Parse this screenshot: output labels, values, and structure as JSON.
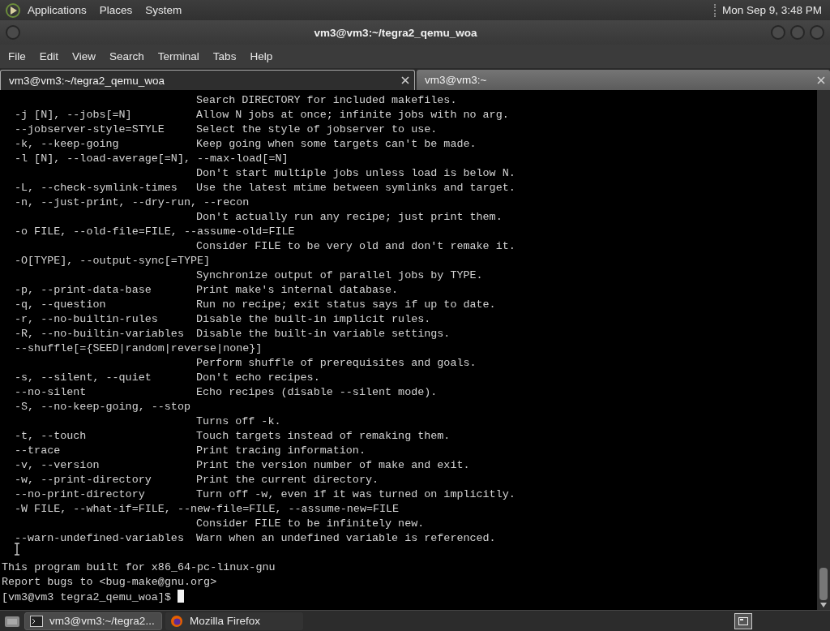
{
  "top_panel": {
    "menus": [
      "Applications",
      "Places",
      "System"
    ],
    "clock": "Mon Sep  9,  3:48 PM"
  },
  "window": {
    "title": "vm3@vm3:~/tegra2_qemu_woa"
  },
  "menu_bar": [
    "File",
    "Edit",
    "View",
    "Search",
    "Terminal",
    "Tabs",
    "Help"
  ],
  "tabs": [
    {
      "label": "vm3@vm3:~/tegra2_qemu_woa",
      "selected": true
    },
    {
      "label": "vm3@vm3:~",
      "selected": false
    }
  ],
  "terminal": {
    "help_rows": [
      {
        "description": "Search DIRECTORY for included makefiles."
      },
      {
        "option": "-j [N], --jobs[=N]",
        "description": "Allow N jobs at once; infinite jobs with no arg."
      },
      {
        "option": "--jobserver-style=STYLE",
        "description": "Select the style of jobserver to use."
      },
      {
        "option": "-k, --keep-going",
        "description": "Keep going when some targets can't be made."
      },
      {
        "option": "-l [N], --load-average[=N], --max-load[=N]"
      },
      {
        "description": "Don't start multiple jobs unless load is below N."
      },
      {
        "option": "-L, --check-symlink-times",
        "description": "Use the latest mtime between symlinks and target."
      },
      {
        "option": "-n, --just-print, --dry-run, --recon"
      },
      {
        "description": "Don't actually run any recipe; just print them."
      },
      {
        "option": "-o FILE, --old-file=FILE, --assume-old=FILE"
      },
      {
        "description": "Consider FILE to be very old and don't remake it."
      },
      {
        "option": "-O[TYPE], --output-sync[=TYPE]"
      },
      {
        "description": "Synchronize output of parallel jobs by TYPE."
      },
      {
        "option": "-p, --print-data-base",
        "description": "Print make's internal database."
      },
      {
        "option": "-q, --question",
        "description": "Run no recipe; exit status says if up to date."
      },
      {
        "option": "-r, --no-builtin-rules",
        "description": "Disable the built-in implicit rules."
      },
      {
        "option": "-R, --no-builtin-variables",
        "description": "Disable the built-in variable settings."
      },
      {
        "option": "--shuffle[={SEED|random|reverse|none}]"
      },
      {
        "description": "Perform shuffle of prerequisites and goals."
      },
      {
        "option": "-s, --silent, --quiet",
        "description": "Don't echo recipes."
      },
      {
        "option": "--no-silent",
        "description": "Echo recipes (disable --silent mode)."
      },
      {
        "option": "-S, --no-keep-going, --stop"
      },
      {
        "description": "Turns off -k."
      },
      {
        "option": "-t, --touch",
        "description": "Touch targets instead of remaking them."
      },
      {
        "option": "--trace",
        "description": "Print tracing information."
      },
      {
        "option": "-v, --version",
        "description": "Print the version number of make and exit."
      },
      {
        "option": "-w, --print-directory",
        "description": "Print the current directory."
      },
      {
        "option": "--no-print-directory",
        "description": "Turn off -w, even if it was turned on implicitly."
      },
      {
        "option": "-W FILE, --what-if=FILE, --new-file=FILE, --assume-new=FILE"
      },
      {
        "description": "Consider FILE to be infinitely new."
      },
      {
        "option": "--warn-undefined-variables",
        "description": "Warn when an undefined variable is referenced."
      }
    ],
    "output_lines": [
      "This program built for x86_64-pc-linux-gnu",
      "Report bugs to <bug-make@gnu.org>"
    ],
    "prompt": "[vm3@vm3 tegra2_qemu_woa]$"
  },
  "taskbar": {
    "tasks": [
      {
        "label": "vm3@vm3:~/tegra2...",
        "kind": "terminal",
        "selected": true
      },
      {
        "label": "Mozilla Firefox",
        "kind": "browser",
        "selected": false
      }
    ]
  }
}
